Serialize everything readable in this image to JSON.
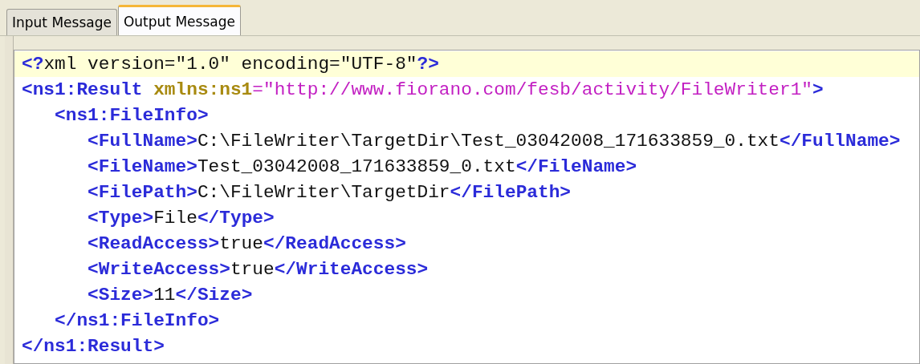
{
  "tabs": [
    {
      "label": "Input Message",
      "selected": false
    },
    {
      "label": "Output Message",
      "selected": true
    }
  ],
  "editor": {
    "prolog": {
      "highlighted": true,
      "tokens": [
        {
          "kind": "punct",
          "text": "<?"
        },
        {
          "kind": "text",
          "text": "xml version=\"1.0\" encoding=\"UTF-8\""
        },
        {
          "kind": "punct",
          "text": "?>"
        }
      ]
    },
    "root": {
      "open": [
        {
          "kind": "tag",
          "text": "<ns1:Result "
        },
        {
          "kind": "attr",
          "text": "xmlns:ns1"
        },
        {
          "kind": "value",
          "text": "=\"http://www.fiorano.com/fesb/activity/FileWriter1\""
        },
        {
          "kind": "tag",
          "text": ">"
        }
      ],
      "close": [
        {
          "kind": "tag",
          "text": "</ns1:Result>"
        }
      ],
      "children": [
        {
          "open": [
            {
              "kind": "tag",
              "text": "<ns1:FileInfo>"
            }
          ],
          "close": [
            {
              "kind": "tag",
              "text": "</ns1:FileInfo>"
            }
          ],
          "children": [
            {
              "open": [
                {
                  "kind": "tag",
                  "text": "<FullName>"
                },
                {
                  "kind": "text",
                  "text": "C:\\FileWriter\\TargetDir\\Test_03042008_171633859_0.txt"
                },
                {
                  "kind": "tag",
                  "text": "</FullName>"
                }
              ]
            },
            {
              "open": [
                {
                  "kind": "tag",
                  "text": "<FileName>"
                },
                {
                  "kind": "text",
                  "text": "Test_03042008_171633859_0.txt"
                },
                {
                  "kind": "tag",
                  "text": "</FileName>"
                }
              ]
            },
            {
              "open": [
                {
                  "kind": "tag",
                  "text": "<FilePath>"
                },
                {
                  "kind": "text",
                  "text": "C:\\FileWriter\\TargetDir"
                },
                {
                  "kind": "tag",
                  "text": "</FilePath>"
                }
              ]
            },
            {
              "open": [
                {
                  "kind": "tag",
                  "text": "<Type>"
                },
                {
                  "kind": "text",
                  "text": "File"
                },
                {
                  "kind": "tag",
                  "text": "</Type>"
                }
              ]
            },
            {
              "open": [
                {
                  "kind": "tag",
                  "text": "<ReadAccess>"
                },
                {
                  "kind": "text",
                  "text": "true"
                },
                {
                  "kind": "tag",
                  "text": "</ReadAccess>"
                }
              ]
            },
            {
              "open": [
                {
                  "kind": "tag",
                  "text": "<WriteAccess>"
                },
                {
                  "kind": "text",
                  "text": "true"
                },
                {
                  "kind": "tag",
                  "text": "</WriteAccess>"
                }
              ]
            },
            {
              "open": [
                {
                  "kind": "tag",
                  "text": "<Size>"
                },
                {
                  "kind": "text",
                  "text": "11"
                },
                {
                  "kind": "tag",
                  "text": "</Size>"
                }
              ]
            }
          ]
        }
      ]
    }
  }
}
